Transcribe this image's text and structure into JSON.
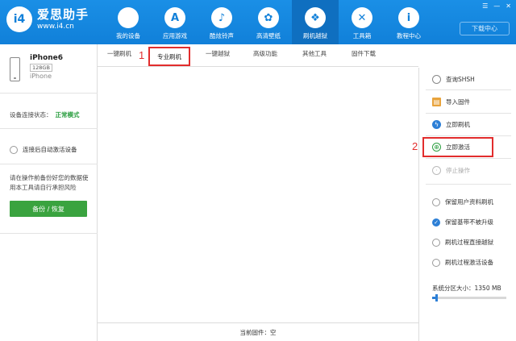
{
  "app": {
    "logo_mark": "i4",
    "name": "爱思助手",
    "url": "www.i4.cn",
    "window_controls": [
      "☰",
      "—",
      "✕"
    ],
    "download_center": "下载中心"
  },
  "nav": [
    {
      "label": "我的设备",
      "icon": "apple-icon",
      "glyph": ""
    },
    {
      "label": "应用游戏",
      "icon": "app-store-icon",
      "glyph": "A"
    },
    {
      "label": "酷炫铃声",
      "icon": "bell-icon",
      "glyph": "♪"
    },
    {
      "label": "高清壁纸",
      "icon": "flower-icon",
      "glyph": "✿"
    },
    {
      "label": "刷机越狱",
      "icon": "dropbox-icon",
      "glyph": "❖"
    },
    {
      "label": "工具箱",
      "icon": "tools-icon",
      "glyph": "✕"
    },
    {
      "label": "教程中心",
      "icon": "info-icon",
      "glyph": "i"
    }
  ],
  "device": {
    "name": "iPhone6",
    "capacity": "128GB",
    "model": "iPhone"
  },
  "status": {
    "label": "设备连接状态：",
    "value": "正常模式"
  },
  "auto_activate": "连接后自动激活设备",
  "warning": "请在操作前备份好您的数据使用本工具请自行承担风险",
  "backup_button": "备份 / 恢复",
  "tabs": [
    "一键刷机",
    "专业刷机",
    "一键越狱",
    "高级功能",
    "其他工具",
    "固件下载"
  ],
  "annotations": {
    "first": "1",
    "second": "2"
  },
  "actions": [
    {
      "label": "查询SHSH",
      "icon": "query-icon",
      "disabled": false
    },
    {
      "label": "导入固件",
      "icon": "import-icon",
      "disabled": false
    },
    {
      "label": "立即刷机",
      "icon": "flash-icon",
      "disabled": false
    },
    {
      "label": "立即激活",
      "icon": "globe-icon",
      "disabled": false
    },
    {
      "label": "停止操作",
      "icon": "stop-icon",
      "disabled": true
    }
  ],
  "options": [
    {
      "label": "保留用户资料刷机",
      "checked": false
    },
    {
      "label": "保留基带不被升级",
      "checked": true
    },
    {
      "label": "刷机过程直接越狱",
      "checked": false
    },
    {
      "label": "刷机过程激活设备",
      "checked": false
    }
  ],
  "partition": {
    "label": "系统分区大小：1350 MB",
    "fill_fraction": 0.05
  },
  "firmware": "当前固件：空",
  "colors": {
    "accent": "#1180d9",
    "green": "#3aa33f",
    "highlight": "#e22d2d",
    "check": "#2d7fd6"
  }
}
